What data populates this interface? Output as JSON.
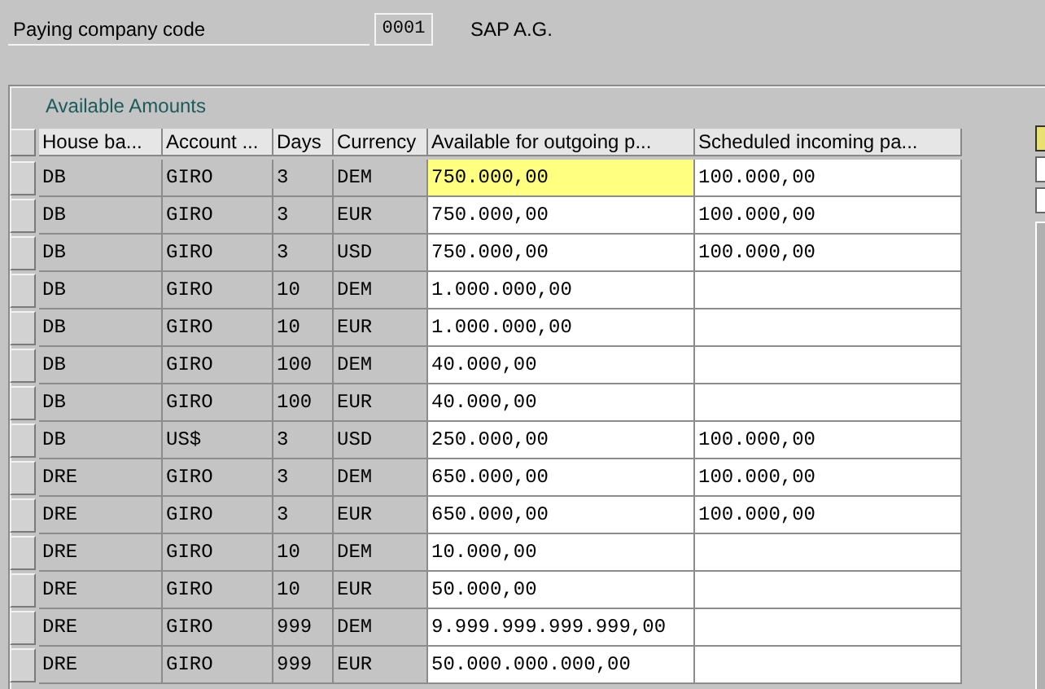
{
  "header": {
    "label": "Paying company code",
    "value": "0001",
    "company_name": "SAP A.G."
  },
  "group": {
    "title": "Available Amounts"
  },
  "table": {
    "columns": [
      "House ba...",
      "Account ...",
      "Days",
      "Currency",
      "Available for outgoing p...",
      "Scheduled incoming pa..."
    ],
    "rows": [
      {
        "cells": [
          "DB",
          "GIRO",
          "3",
          "DEM",
          "750.000,00",
          "100.000,00"
        ],
        "focused": true
      },
      {
        "cells": [
          "DB",
          "GIRO",
          "3",
          "EUR",
          "750.000,00",
          "100.000,00"
        ],
        "focused": false
      },
      {
        "cells": [
          "DB",
          "GIRO",
          "3",
          "USD",
          "750.000,00",
          "100.000,00"
        ],
        "focused": false
      },
      {
        "cells": [
          "DB",
          "GIRO",
          "10",
          "DEM",
          "1.000.000,00",
          ""
        ],
        "focused": false
      },
      {
        "cells": [
          "DB",
          "GIRO",
          "10",
          "EUR",
          "1.000.000,00",
          ""
        ],
        "focused": false
      },
      {
        "cells": [
          "DB",
          "GIRO",
          "100",
          "DEM",
          "40.000,00",
          ""
        ],
        "focused": false
      },
      {
        "cells": [
          "DB",
          "GIRO",
          "100",
          "EUR",
          "40.000,00",
          ""
        ],
        "focused": false
      },
      {
        "cells": [
          "DB",
          "US$",
          "3",
          "USD",
          "250.000,00",
          "100.000,00"
        ],
        "focused": false
      },
      {
        "cells": [
          "DRE",
          "GIRO",
          "3",
          "DEM",
          "650.000,00",
          "100.000,00"
        ],
        "focused": false
      },
      {
        "cells": [
          "DRE",
          "GIRO",
          "3",
          "EUR",
          "650.000,00",
          "100.000,00"
        ],
        "focused": false
      },
      {
        "cells": [
          "DRE",
          "GIRO",
          "10",
          "DEM",
          "10.000,00",
          ""
        ],
        "focused": false
      },
      {
        "cells": [
          "DRE",
          "GIRO",
          "10",
          "EUR",
          "50.000,00",
          ""
        ],
        "focused": false
      },
      {
        "cells": [
          "DRE",
          "GIRO",
          "999",
          "DEM",
          "9.999.999.999.999,00",
          ""
        ],
        "focused": false
      },
      {
        "cells": [
          "DRE",
          "GIRO",
          "999",
          "EUR",
          "50.000.000.000,00",
          ""
        ],
        "focused": false
      }
    ]
  }
}
